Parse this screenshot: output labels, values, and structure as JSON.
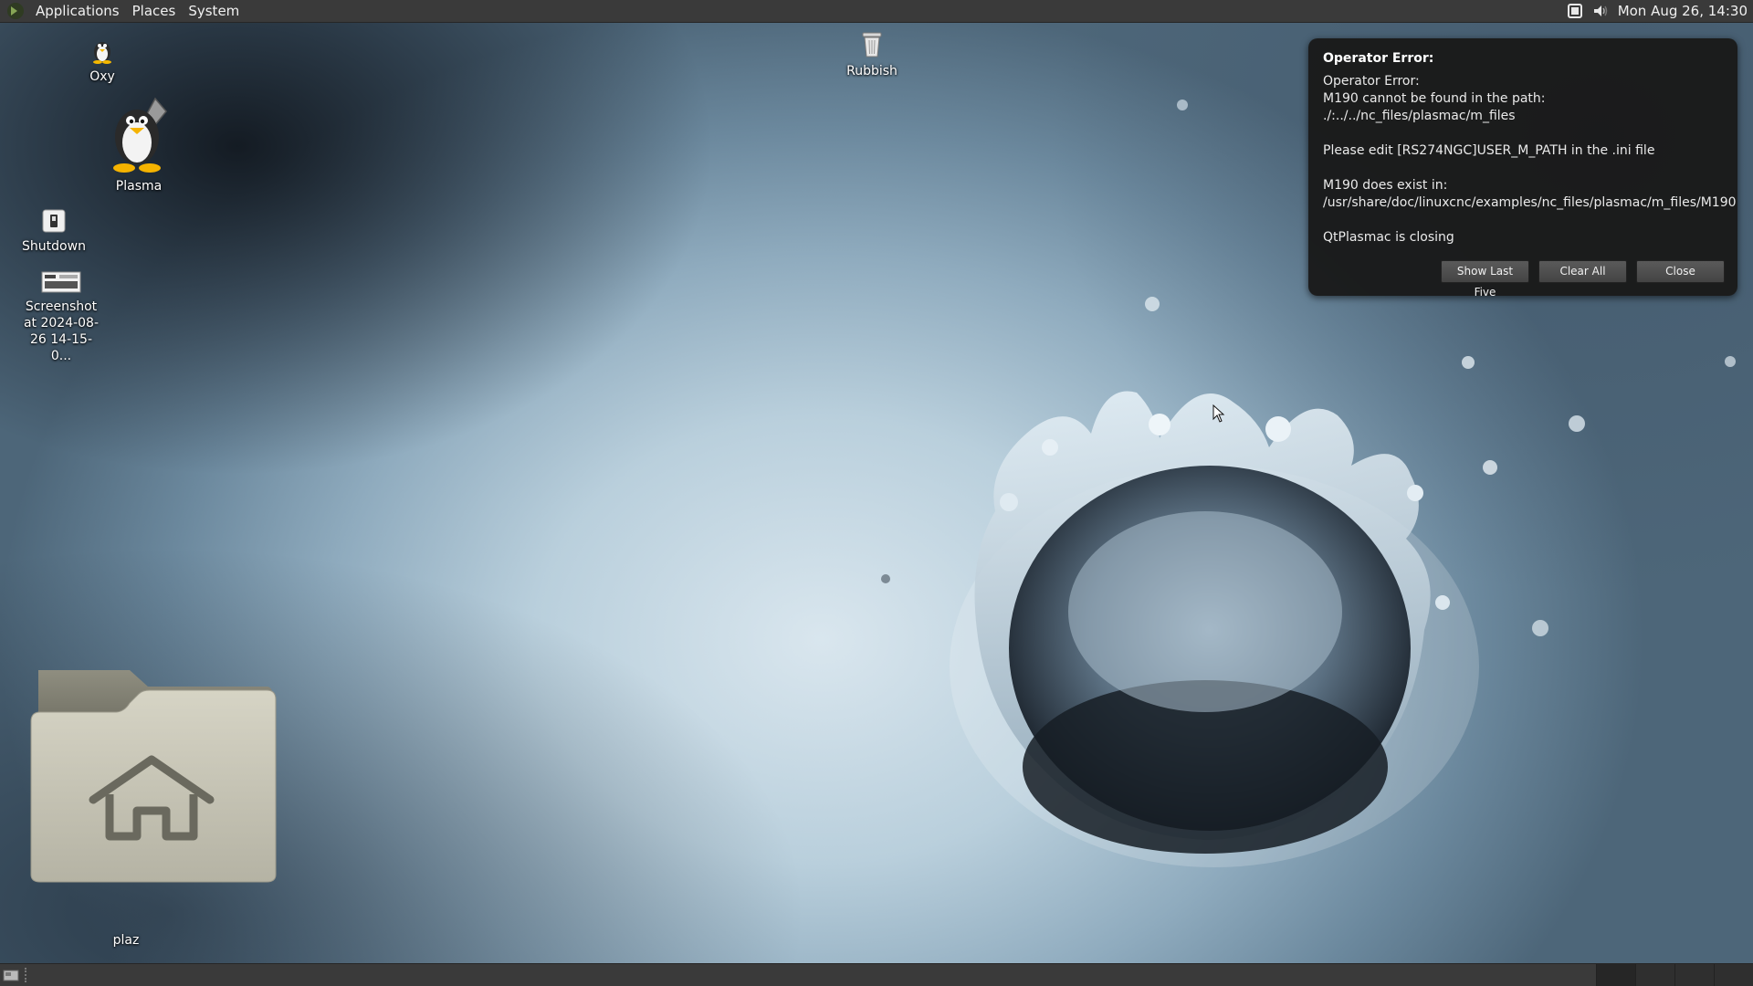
{
  "top_panel": {
    "menus": [
      "Applications",
      "Places",
      "System"
    ],
    "clock": "Mon Aug 26, 14:30"
  },
  "desktop": {
    "icons": {
      "oxy": "Oxy",
      "plasma": "Plasma",
      "shutdown": "Shutdown",
      "screenshot": [
        "Screenshot",
        "at 2024-08-",
        "26 14-15-0..."
      ],
      "rubbish": "Rubbish",
      "home": "plaz"
    }
  },
  "notification": {
    "title": "Operator Error:",
    "lines": [
      "Operator Error:",
      "M190 cannot be found in the path:",
      "./:../../nc_files/plasmac/m_files",
      "",
      "Please edit [RS274NGC]USER_M_PATH in the .ini file",
      "",
      "M190 does exist in:",
      "/usr/share/doc/linuxcnc/examples/nc_files/plasmac/m_files/M190",
      "",
      "QtPlasmac is closing"
    ],
    "buttons": {
      "show_last_five": "Show Last Five",
      "clear_all": "Clear All",
      "close": "Close"
    }
  },
  "colors": {
    "panel": "#3a3a3a",
    "notification_bg": "#191919",
    "folder": "#c9c7b8"
  },
  "icon_names": [
    "mate-logo-icon",
    "oxy-icon",
    "plasma-penguin-icon",
    "shutdown-icon",
    "screenshot-file-icon",
    "trash-icon",
    "home-folder-icon",
    "display-icon",
    "volume-icon",
    "show-desktop-icon",
    "mouse-cursor-icon"
  ]
}
